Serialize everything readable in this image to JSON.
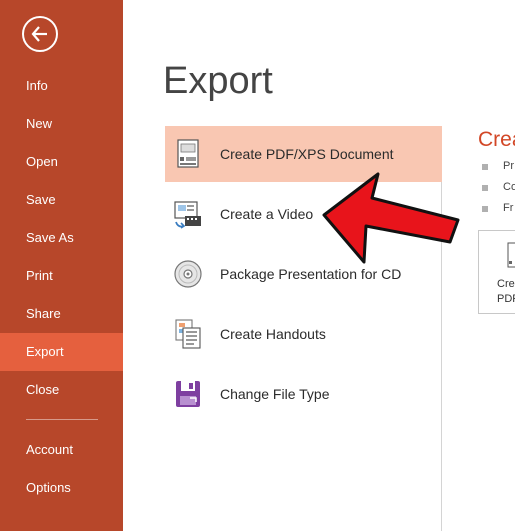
{
  "sidebar": {
    "items": [
      {
        "label": "Info"
      },
      {
        "label": "New"
      },
      {
        "label": "Open"
      },
      {
        "label": "Save"
      },
      {
        "label": "Save As"
      },
      {
        "label": "Print"
      },
      {
        "label": "Share"
      },
      {
        "label": "Export"
      },
      {
        "label": "Close"
      },
      {
        "label": "Account"
      },
      {
        "label": "Options"
      }
    ],
    "active_item": "Export"
  },
  "main": {
    "title": "Export",
    "options": [
      {
        "label": "Create PDF/XPS Document",
        "icon": "pdf-document-icon"
      },
      {
        "label": "Create a Video",
        "icon": "video-icon"
      },
      {
        "label": "Package Presentation for CD",
        "icon": "cd-icon"
      },
      {
        "label": "Create Handouts",
        "icon": "handouts-icon"
      },
      {
        "label": "Change File Type",
        "icon": "file-type-icon"
      }
    ],
    "selected_option": "Create PDF/XPS Document"
  },
  "detail": {
    "title_partial": "Crea",
    "bullets": [
      "Pr",
      "Co",
      "Fr"
    ],
    "button_line1": "Cre",
    "button_line2": "PDF"
  },
  "colors": {
    "sidebar_bg": "#b7472a",
    "sidebar_active": "#e5603e",
    "selected_option_bg": "#f9c7b2",
    "accent": "#d24726",
    "annotation_arrow": "#e8141b"
  }
}
